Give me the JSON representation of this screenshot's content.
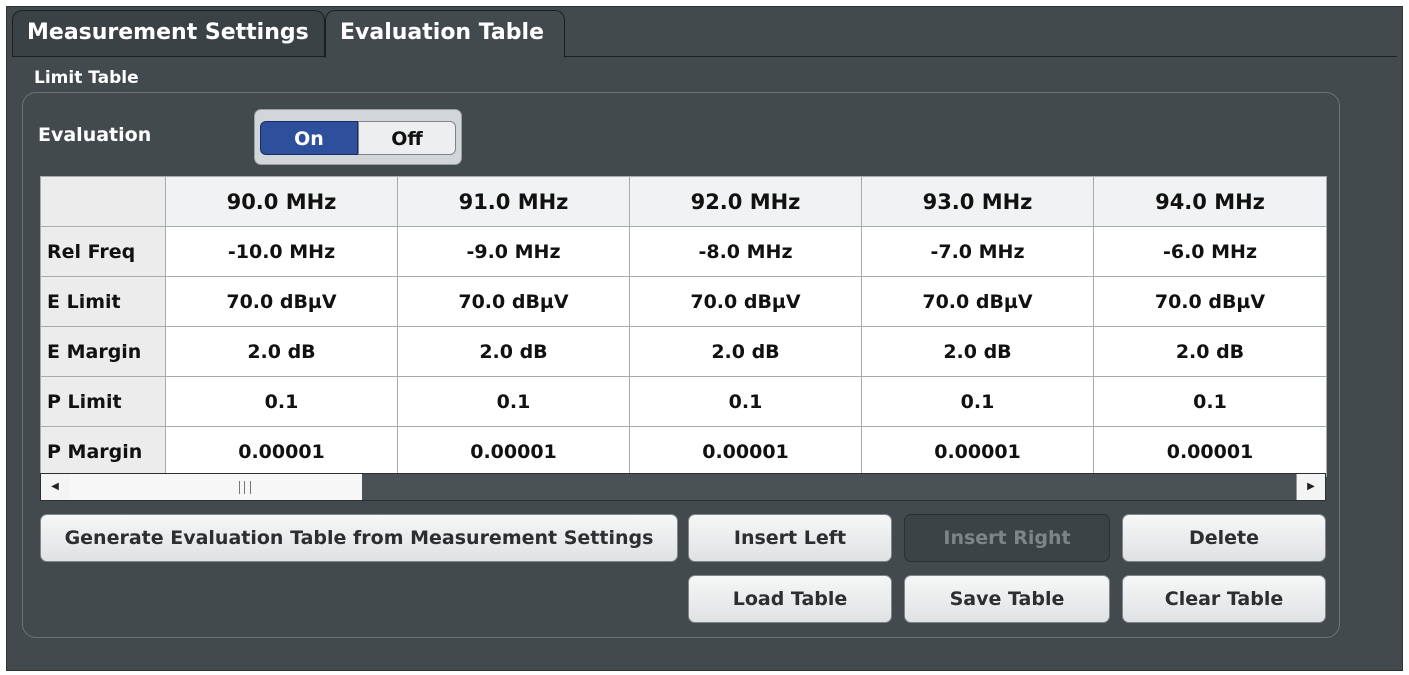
{
  "tabs": [
    {
      "label": "Measurement Settings",
      "active": false
    },
    {
      "label": "Evaluation Table",
      "active": true
    }
  ],
  "group_label": "Limit Table",
  "evaluation": {
    "label": "Evaluation",
    "on_label": "On",
    "off_label": "Off",
    "selected": "On"
  },
  "table": {
    "columns": [
      "90.0 MHz",
      "91.0 MHz",
      "92.0 MHz",
      "93.0 MHz",
      "94.0 MHz"
    ],
    "rows": [
      {
        "header": "Rel Freq",
        "cells": [
          "-10.0 MHz",
          "-9.0 MHz",
          "-8.0 MHz",
          "-7.0 MHz",
          "-6.0 MHz"
        ]
      },
      {
        "header": "E Limit",
        "cells": [
          "70.0 dBµV",
          "70.0 dBµV",
          "70.0 dBµV",
          "70.0 dBµV",
          "70.0 dBµV"
        ]
      },
      {
        "header": "E Margin",
        "cells": [
          "2.0 dB",
          "2.0 dB",
          "2.0 dB",
          "2.0 dB",
          "2.0 dB"
        ]
      },
      {
        "header": "P Limit",
        "cells": [
          "0.1",
          "0.1",
          "0.1",
          "0.1",
          "0.1"
        ]
      },
      {
        "header": "P Margin",
        "cells": [
          "0.00001",
          "0.00001",
          "0.00001",
          "0.00001",
          "0.00001"
        ]
      }
    ]
  },
  "buttons": {
    "generate": "Generate Evaluation Table from Measurement Settings",
    "insert_left": "Insert Left",
    "insert_right": "Insert Right",
    "delete": "Delete",
    "load_table": "Load Table",
    "save_table": "Save Table",
    "clear_table": "Clear Table"
  },
  "icons": {
    "scroll_left": "arrow-left-icon",
    "scroll_right": "arrow-right-icon",
    "scroll_grip": "grip-icon"
  },
  "colors": {
    "background": "#434a4e",
    "toggle_on": "#2e4f9c",
    "button": "#e6e8e9"
  }
}
